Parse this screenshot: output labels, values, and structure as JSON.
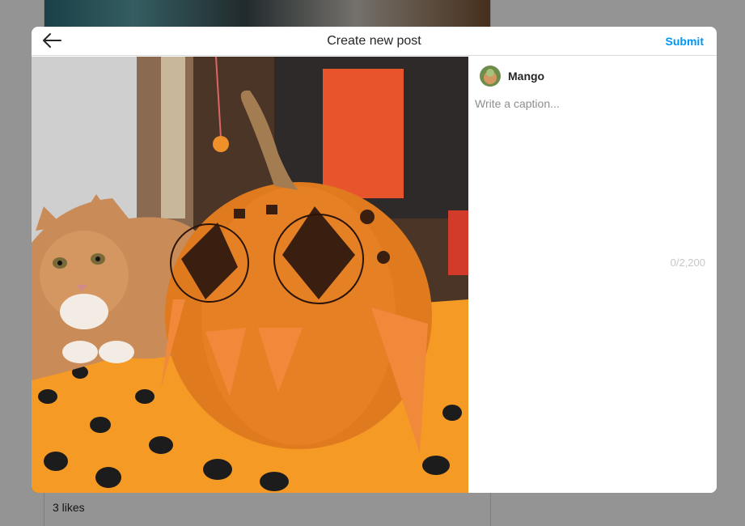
{
  "feed": {
    "likes": "3 likes"
  },
  "modal": {
    "title": "Create new post",
    "submit_label": "Submit",
    "back_icon": "arrow-left-icon"
  },
  "post": {
    "username": "Mango",
    "caption_placeholder": "Write a caption...",
    "caption_value": "",
    "char_counter": "0/2,200"
  },
  "colors": {
    "accent": "#0095f6",
    "text": "#262626",
    "muted": "#8e8e8e",
    "border": "#dbdbdb"
  }
}
